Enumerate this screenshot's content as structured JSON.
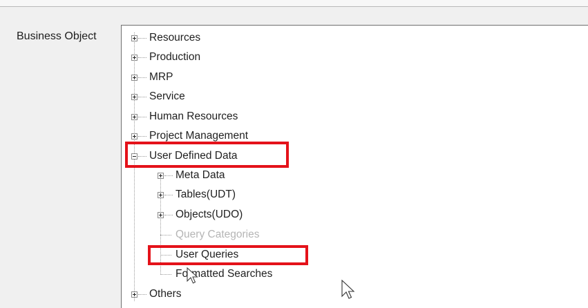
{
  "form": {
    "label": "Business Object"
  },
  "tree": {
    "top_nodes": [
      {
        "label": "Resources",
        "expanded": false
      },
      {
        "label": "Production",
        "expanded": false
      },
      {
        "label": "MRP",
        "expanded": false
      },
      {
        "label": "Service",
        "expanded": false
      },
      {
        "label": "Human Resources",
        "expanded": false
      },
      {
        "label": "Project Management",
        "expanded": false
      },
      {
        "label": "User Defined Data",
        "expanded": true
      }
    ],
    "user_defined_children": [
      {
        "label": "Meta Data",
        "expandable": true
      },
      {
        "label": "Tables(UDT)",
        "expandable": true
      },
      {
        "label": "Objects(UDO)",
        "expandable": true
      },
      {
        "label": "Query Categories",
        "expandable": false,
        "disabled": true
      },
      {
        "label": "User Queries",
        "expandable": false
      },
      {
        "label": "Formatted Searches",
        "expandable": false
      }
    ],
    "last_node": {
      "label": "Others",
      "expanded": false
    }
  },
  "highlight_color": "#e4121a"
}
